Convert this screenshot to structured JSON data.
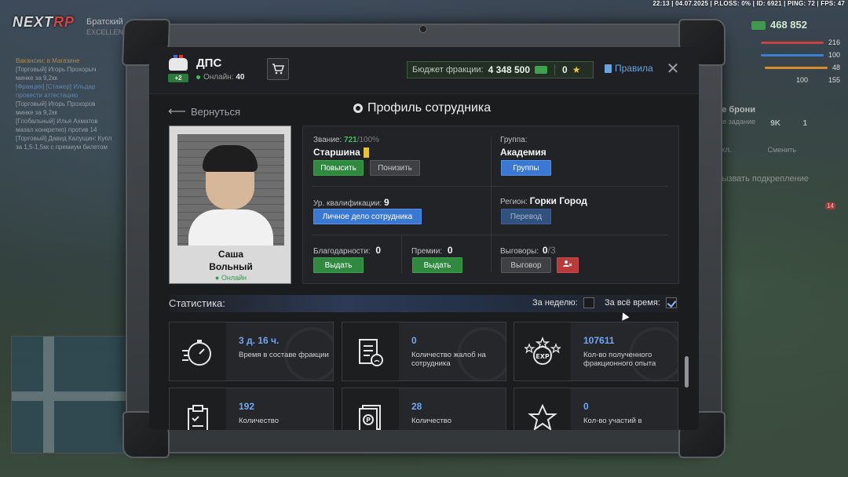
{
  "statusbar": "22:13 | 04.07.2025 | P.LOSS: 0% | ID: 6921 | PING: 72 | FPS: 47",
  "hud": {
    "logo_a": "NEXT",
    "logo_b": "RP",
    "server": "Братский",
    "server_sub": "EXCELLENCE",
    "money": "468 852",
    "stats": [
      "216",
      "100",
      "48",
      "155"
    ],
    "stat_extra": "100",
    "brony": "ние брони",
    "zadanie": "ое задание",
    "vykl": "кл.",
    "smenit": "Сменить",
    "podkreplenie": "вызвать подкрепление",
    "count_9k": "9K",
    "count_1": "1",
    "badge_14": "14"
  },
  "chat": [
    "Вакансии: в Магазине",
    "[Торговый] Игорь Прохорыч",
    "минке за 9,2кк",
    "[Фракция] [Стажер] Ильдар",
    "провести аттестацию",
    "[Торговый] Игорь Прохоров",
    "минке за 9,2кк",
    "[Глобальный] Илья Ахматов",
    "мазал конкретно) против 14",
    "[Торговый] Давид Калущин: Купл",
    "за 1,5-1,5кк с премиум билетом"
  ],
  "header": {
    "faction": "ДПС",
    "online_label": "Онлайн:",
    "online_count": "40",
    "rank_badge": "+2",
    "budget_label": "Бюджет фракции:",
    "budget_amount": "4 348 500",
    "stars": "0",
    "rules": "Правила"
  },
  "nav": {
    "back": "Вернуться",
    "title": "Профиль сотрудника"
  },
  "profile": {
    "first_name": "Саша",
    "last_name": "Вольный",
    "status": "Онлайн"
  },
  "info": {
    "rank_label": "Звание:",
    "rank_points": "721",
    "rank_max": "/100%",
    "rank_value": "Старшина",
    "promote": "Повысить",
    "demote": "Понизить",
    "group_label": "Группа:",
    "group_value": "Академия",
    "groups_btn": "Группы",
    "qual_label": "Ур. квалификации:",
    "qual_value": "9",
    "personal_file": "Личное дело сотрудника",
    "region_label": "Регион:",
    "region_value": "Горки Город",
    "transfer": "Перевод",
    "thanks_label": "Благодарности:",
    "thanks_value": "0",
    "thanks_btn": "Выдать",
    "bonus_label": "Премии:",
    "bonus_value": "0",
    "bonus_btn": "Выдать",
    "reprimand_label": "Выговоры:",
    "reprimand_value": "0",
    "reprimand_max": "/3",
    "reprimand_btn": "Выговор"
  },
  "stats": {
    "title": "Статистика:",
    "week": "За неделю:",
    "all_time": "За всё время:",
    "week_checked": false,
    "all_checked": true,
    "tiles": [
      {
        "num": "3 д. 16 ч.",
        "desc": "Время в составе фракции",
        "icon": "stopwatch-icon"
      },
      {
        "num": "0",
        "desc": "Количество жалоб на сотрудника",
        "icon": "complaint-icon"
      },
      {
        "num": "107611",
        "desc": "Кол-во полученного фракционного опыта",
        "icon": "exp-icon"
      },
      {
        "num": "192",
        "desc": "Количество",
        "icon": "clipboard-icon"
      },
      {
        "num": "28",
        "desc": "Количество",
        "icon": "fine-icon"
      },
      {
        "num": "0",
        "desc": "Кол-во участий в",
        "icon": "star-icon"
      }
    ]
  }
}
